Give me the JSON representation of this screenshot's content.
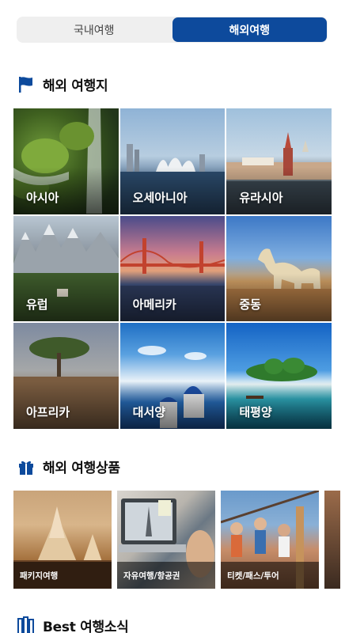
{
  "tabs": [
    {
      "label": "국내여행",
      "active": false
    },
    {
      "label": "해외여행",
      "active": true
    }
  ],
  "sections": {
    "destinations": {
      "title": "해외 여행지",
      "icon": "flag-icon"
    },
    "products": {
      "title": "해외 여행상품",
      "icon": "gift-icon"
    },
    "news": {
      "title": "Best 여행소식",
      "icon": "books-icon"
    }
  },
  "destinations": [
    {
      "label": "아시아"
    },
    {
      "label": "오세아니아"
    },
    {
      "label": "유라시아"
    },
    {
      "label": "유럽"
    },
    {
      "label": "아메리카"
    },
    {
      "label": "중동"
    },
    {
      "label": "아프리카"
    },
    {
      "label": "대서양"
    },
    {
      "label": "태평양"
    }
  ],
  "products": [
    {
      "label": "패키지여행"
    },
    {
      "label": "자유여행/항공권"
    },
    {
      "label": "티켓/패스/투어"
    }
  ],
  "colors": {
    "accent": "#0d4a9c",
    "tab_bg": "#efefef"
  }
}
